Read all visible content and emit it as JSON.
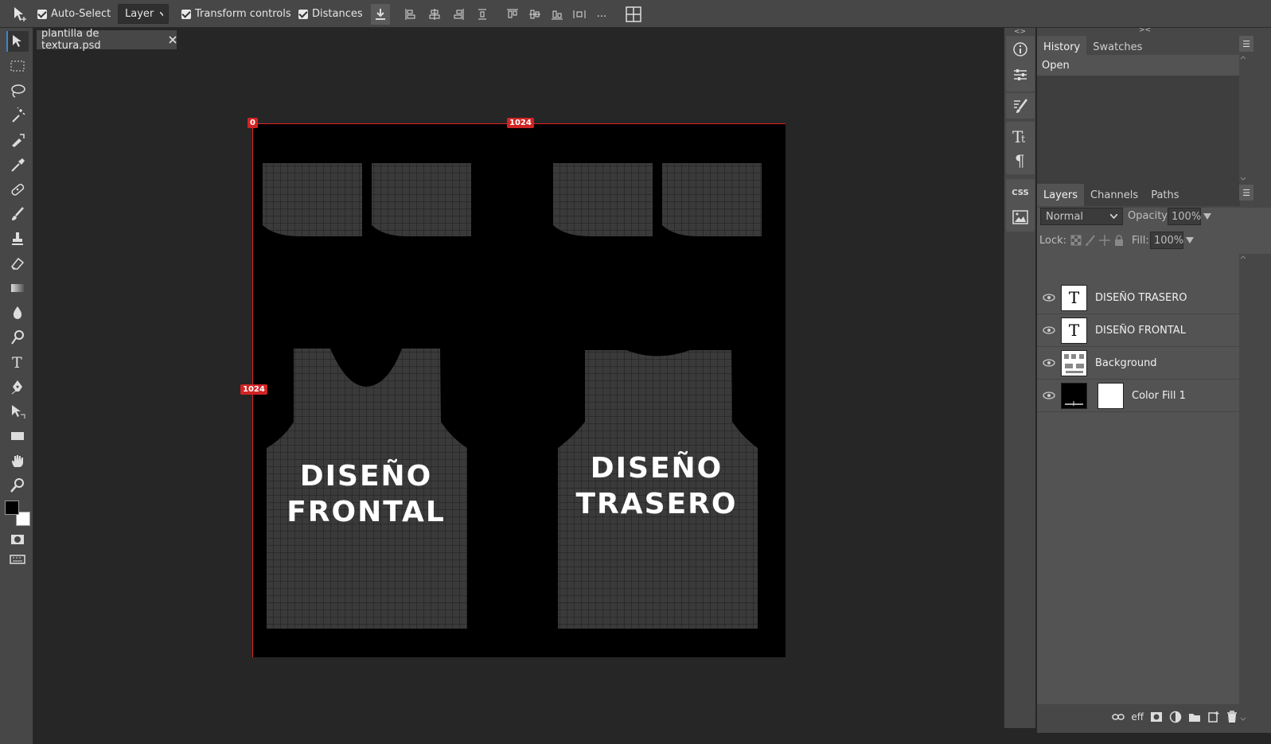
{
  "toolbar": {
    "auto_select_label": "Auto-Select",
    "layer_select_value": "Layer",
    "transform_controls_label": "Transform controls",
    "distances_label": "Distances",
    "more_label": "..."
  },
  "document": {
    "tab_title": "plantilla de textura.psd",
    "ruler_origin": "0",
    "ruler_width": "1024",
    "ruler_height": "1024",
    "front_text_line1": "DISEÑO",
    "front_text_line2": "FRONTAL",
    "back_text_line1": "DISEÑO",
    "back_text_line2": "TRASERO"
  },
  "history_panel": {
    "tabs": [
      "History",
      "Swatches"
    ],
    "items": [
      "Open"
    ]
  },
  "layers_panel": {
    "tabs": [
      "Layers",
      "Channels",
      "Paths"
    ],
    "blend_mode": "Normal",
    "opacity_label": "Opacity:",
    "opacity_value": "100%",
    "lock_label": "Lock:",
    "fill_label": "Fill:",
    "fill_value": "100%",
    "layers": [
      {
        "name": "DISEÑO TRASERO",
        "type": "text",
        "thumb": "T"
      },
      {
        "name": "DISEÑO FRONTAL",
        "type": "text",
        "thumb": "T"
      },
      {
        "name": "Background",
        "type": "image"
      },
      {
        "name": "Color Fill 1",
        "type": "fill"
      }
    ],
    "footer_eff_label": "eff"
  },
  "mid_strip": {
    "css_label": "CSS"
  },
  "colors": {
    "accent": "#3d84d1",
    "guide": "#e02020",
    "foreground": "#000000",
    "background": "#ffffff"
  }
}
